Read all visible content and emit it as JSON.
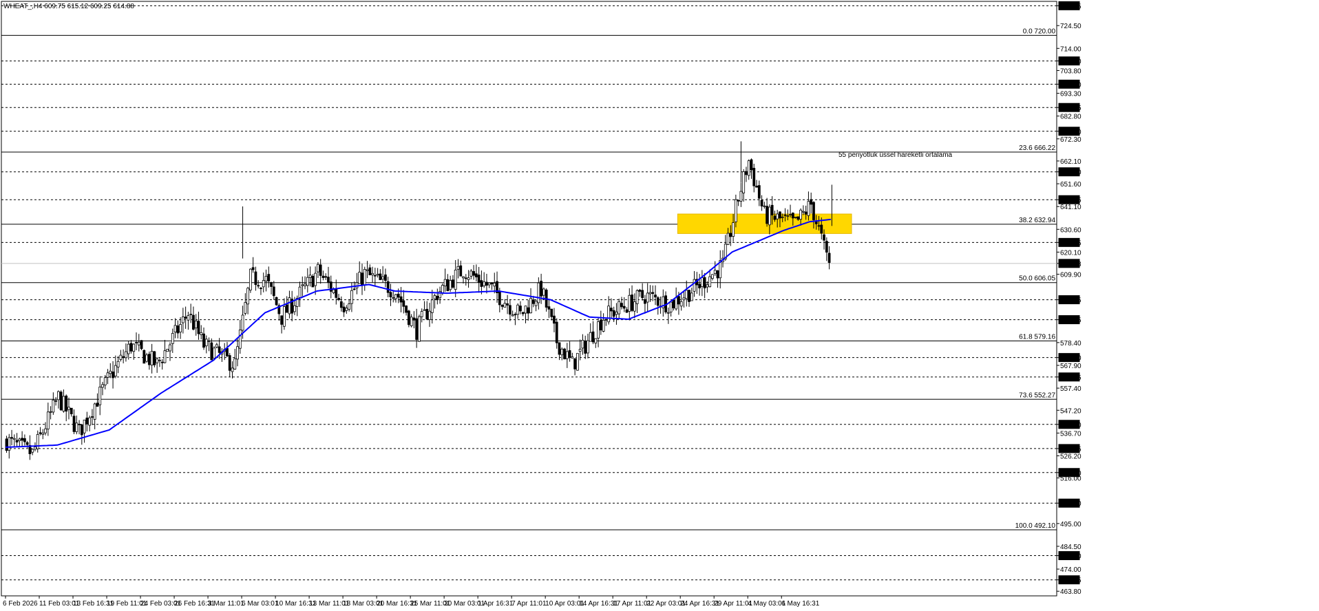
{
  "header": {
    "symbol_info": "WHEAT_,H4  609.75 615.12 609.25 614.88"
  },
  "annotation": {
    "text": "55 periyotluk üssel hareketli ortalama",
    "color": "#0000ff"
  },
  "colors": {
    "ema": "#0000ff",
    "zone": "#ffd700",
    "grid": "#000000",
    "candle": "#000000",
    "price_marker_bg": "#000000"
  },
  "chart_data": {
    "type": "candlestick",
    "ylim": [
      461.5,
      735.5
    ],
    "y_ticks": [
      "733.65",
      "724.50",
      "714.00",
      "708.20",
      "703.80",
      "697.50",
      "693.30",
      "686.75",
      "682.80",
      "675.80",
      "672.30",
      "662.10",
      "657.10",
      "651.60",
      "644.25",
      "641.10",
      "630.60",
      "624.55",
      "620.10",
      "614.88",
      "609.90",
      "598.15",
      "588.95",
      "578.40",
      "571.50",
      "567.90",
      "562.55",
      "557.40",
      "547.20",
      "540.70",
      "536.70",
      "529.55",
      "526.20",
      "518.50",
      "516.00",
      "504.40",
      "495.00",
      "484.50",
      "480.20",
      "474.00",
      "469.05",
      "463.80"
    ],
    "y_tick_values": [
      733.65,
      724.5,
      714.0,
      708.2,
      703.8,
      697.5,
      693.3,
      686.75,
      682.8,
      675.8,
      672.3,
      662.1,
      657.1,
      651.6,
      644.25,
      641.1,
      630.6,
      624.55,
      620.1,
      614.88,
      609.9,
      598.15,
      588.95,
      578.4,
      571.5,
      567.9,
      562.55,
      557.4,
      547.2,
      540.7,
      536.7,
      529.55,
      526.2,
      518.5,
      516.0,
      504.4,
      495.0,
      484.5,
      480.2,
      474.0,
      469.05,
      463.8
    ],
    "boxed_levels": [
      "733.65",
      "708.20",
      "697.50",
      "686.75",
      "675.80",
      "657.10",
      "644.25",
      "624.55",
      "614.88",
      "598.15",
      "588.95",
      "571.50",
      "562.55",
      "540.70",
      "529.55",
      "518.50",
      "504.40",
      "480.20",
      "469.05"
    ],
    "boxed_level_values": [
      733.65,
      708.2,
      697.5,
      686.75,
      675.8,
      657.1,
      644.25,
      624.55,
      614.88,
      598.15,
      588.95,
      571.5,
      562.55,
      540.7,
      529.55,
      518.5,
      504.4,
      480.2,
      469.05
    ],
    "dashed_levels": [
      733.65,
      708.2,
      697.5,
      686.75,
      675.8,
      657.1,
      644.25,
      624.55,
      598.15,
      588.95,
      571.5,
      562.55,
      540.7,
      529.55,
      518.5,
      504.4,
      480.2,
      469.05
    ],
    "current_price": 614.88,
    "fibonacci": [
      {
        "label": "0.0 720.00",
        "value": 720.0
      },
      {
        "label": "23.6 666.22",
        "value": 666.22
      },
      {
        "label": "38.2 632.94",
        "value": 632.94
      },
      {
        "label": "50.0 606.05",
        "value": 606.05
      },
      {
        "label": "61.8 579.16",
        "value": 579.16
      },
      {
        "label": "73.6 552.27",
        "value": 552.27
      },
      {
        "label": "100.0 492.10",
        "value": 492.1
      }
    ],
    "x_labels": [
      "6 Feb 2026",
      "11 Feb 03:01",
      "13 Feb 16:31",
      "19 Feb 11:01",
      "24 Feb 03:01",
      "26 Feb 16:31",
      "3 Mar 11:01",
      "6 Mar 03:01",
      "10 Mar 16:31",
      "13 Mar 11:01",
      "18 Mar 03:01",
      "20 Mar 16:31",
      "25 Mar 11:01",
      "30 Mar 03:01",
      "1 Apr 16:31",
      "7 Apr 11:01",
      "10 Apr 03:01",
      "14 Apr 16:31",
      "17 Apr 11:01",
      "22 Apr 03:01",
      "24 Apr 16:31",
      "29 Apr 11:01",
      "4 May 03:01",
      "6 May 16:31"
    ],
    "x_label_index": [
      0,
      13,
      26,
      39,
      52,
      65,
      78,
      91,
      104,
      117,
      130,
      143,
      156,
      169,
      182,
      195,
      208,
      221,
      234,
      247,
      260,
      273,
      286,
      299
    ],
    "zone": {
      "from_index": 259,
      "to_index": 326,
      "low": 628.5,
      "high": 637.5
    },
    "ema_period": 55,
    "candle_count": 318,
    "close_anchors": [
      [
        0,
        533
      ],
      [
        10,
        527
      ],
      [
        20,
        553
      ],
      [
        28,
        537
      ],
      [
        40,
        563
      ],
      [
        48,
        577
      ],
      [
        58,
        568
      ],
      [
        70,
        592
      ],
      [
        76,
        577
      ],
      [
        88,
        568
      ],
      [
        94,
        608
      ],
      [
        100,
        607
      ],
      [
        106,
        590
      ],
      [
        120,
        611
      ],
      [
        130,
        596
      ],
      [
        138,
        610
      ],
      [
        150,
        602
      ],
      [
        158,
        584
      ],
      [
        166,
        601
      ],
      [
        176,
        612
      ],
      [
        186,
        604
      ],
      [
        198,
        591
      ],
      [
        206,
        603
      ],
      [
        212,
        579
      ],
      [
        218,
        568
      ],
      [
        230,
        590
      ],
      [
        246,
        600
      ],
      [
        256,
        596
      ],
      [
        266,
        604
      ],
      [
        276,
        614
      ],
      [
        282,
        645
      ],
      [
        286,
        662
      ],
      [
        292,
        637
      ],
      [
        304,
        633
      ],
      [
        310,
        642
      ],
      [
        316,
        618
      ],
      [
        318,
        612
      ],
      [
        324,
        614
      ]
    ],
    "ema_anchors": [
      [
        0,
        530
      ],
      [
        20,
        531
      ],
      [
        40,
        538
      ],
      [
        60,
        555
      ],
      [
        80,
        570
      ],
      [
        100,
        592
      ],
      [
        120,
        602
      ],
      [
        140,
        605
      ],
      [
        150,
        602
      ],
      [
        170,
        601
      ],
      [
        190,
        602
      ],
      [
        210,
        598
      ],
      [
        225,
        590
      ],
      [
        240,
        589
      ],
      [
        255,
        596
      ],
      [
        270,
        610
      ],
      [
        280,
        620
      ],
      [
        300,
        630
      ],
      [
        310,
        634
      ],
      [
        318,
        635
      ]
    ]
  }
}
